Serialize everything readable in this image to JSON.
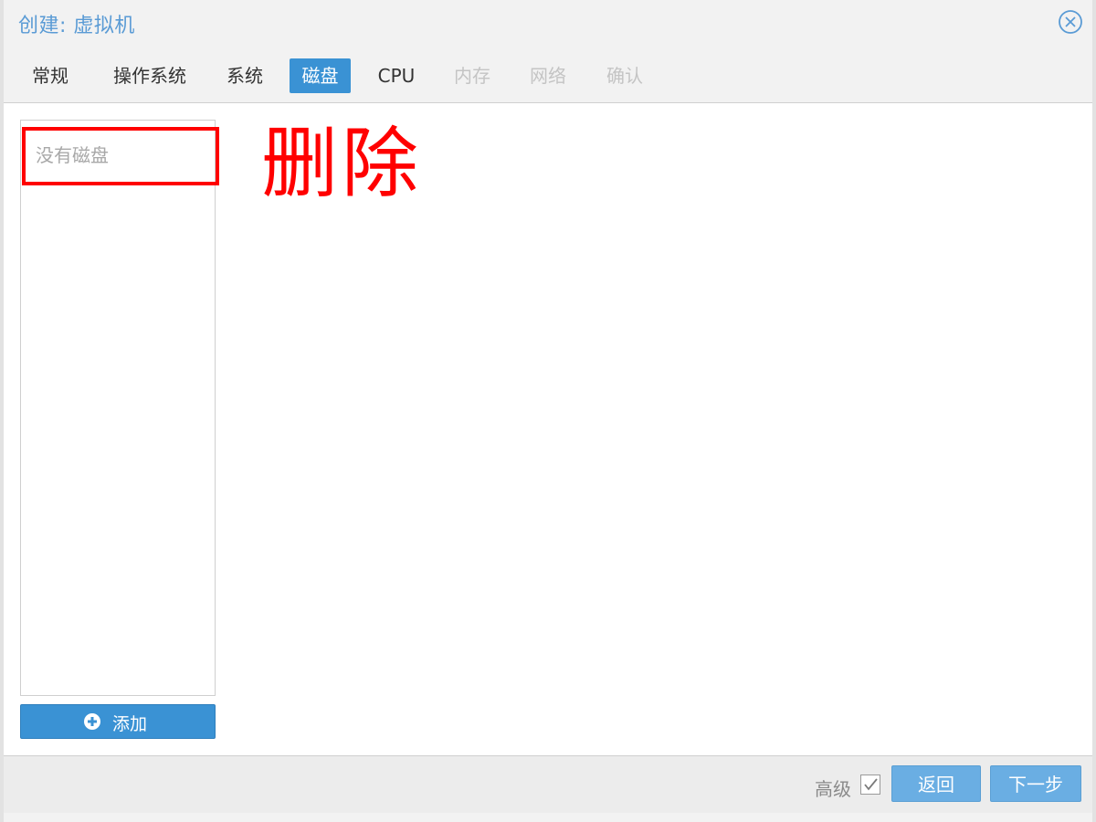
{
  "window": {
    "title": "创建: 虚拟机",
    "close_icon": "close-circle-icon"
  },
  "tabs": [
    {
      "label": "常规",
      "state": "normal"
    },
    {
      "label": "操作系统",
      "state": "normal"
    },
    {
      "label": "系统",
      "state": "normal"
    },
    {
      "label": "磁盘",
      "state": "active"
    },
    {
      "label": "CPU",
      "state": "normal"
    },
    {
      "label": "内存",
      "state": "disabled"
    },
    {
      "label": "网络",
      "state": "disabled"
    },
    {
      "label": "确认",
      "state": "disabled"
    }
  ],
  "disk_panel": {
    "empty_text": "没有磁盘",
    "add_button_label": "添加",
    "add_icon": "plus-circle-icon"
  },
  "annotation": {
    "text": "删除",
    "color": "#ff0000"
  },
  "footer": {
    "advanced_label": "高级",
    "advanced_checked": true,
    "back_label": "返回",
    "next_label": "下一步"
  },
  "colors": {
    "accent": "#3a92d4",
    "title": "#5a9bd5",
    "footer_button": "#6aaee3"
  }
}
